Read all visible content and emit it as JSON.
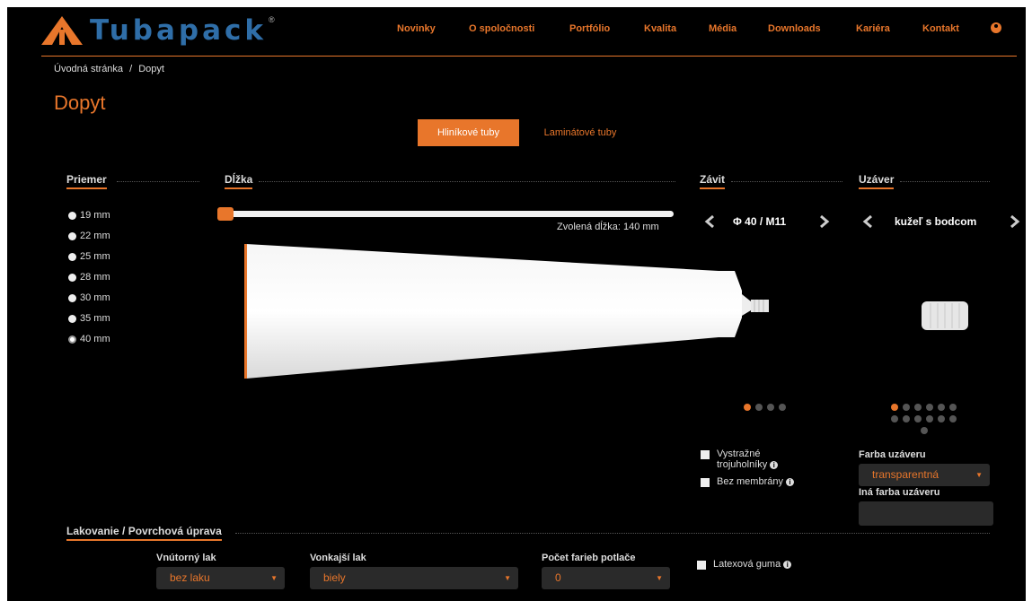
{
  "brand": {
    "name": "Tubapack",
    "reg": "®",
    "color": "#2f6ea8",
    "accent": "#e8762b"
  },
  "nav": {
    "items": [
      {
        "label": "Novinky"
      },
      {
        "label": "O spoločnosti"
      },
      {
        "label": "Portfólio"
      },
      {
        "label": "Kvalita"
      },
      {
        "label": "Média"
      },
      {
        "label": "Downloads"
      },
      {
        "label": "Kariéra"
      },
      {
        "label": "Kontakt"
      }
    ],
    "user_icon": "user-circle-icon"
  },
  "breadcrumb": {
    "home": "Úvodná stránka",
    "sep": "/",
    "current": "Dopyt"
  },
  "page": {
    "title": "Dopyt"
  },
  "tabs": {
    "aluminum": "Hliníkové tuby",
    "laminate": "Laminátové tuby",
    "active": "aluminum"
  },
  "sections": {
    "diameter": "Priemer",
    "length": "Dĺžka",
    "thread": "Závit",
    "cap": "Uzáver",
    "lacquer": "Lakovanie / Povrchová úprava"
  },
  "diameters": [
    "19 mm",
    "22 mm",
    "25 mm",
    "28 mm",
    "30 mm",
    "35 mm",
    "40 mm"
  ],
  "selected_diameter": "40 mm",
  "length": {
    "note": "Zvolená dĺžka: 140 mm",
    "value_mm": 140
  },
  "thread": {
    "label": "Φ 40 / M11",
    "page": 1,
    "pages": 4
  },
  "cap": {
    "label": "kužeľ s bodcom",
    "page": 1,
    "pages": 13
  },
  "options": {
    "warning_triangles": "Vystražné trojuholníky",
    "no_membrane": "Bez membrány",
    "latex": "Latexová guma"
  },
  "cap_color": {
    "label": "Farba uzáveru",
    "value": "transparentná",
    "other_label": "Iná farba uzáveru",
    "other_value": ""
  },
  "lacquer": {
    "inner": {
      "label": "Vnútorný lak",
      "value": "bez laku"
    },
    "outer": {
      "label": "Vonkajší lak",
      "value": "biely"
    },
    "colors": {
      "label": "Počet farieb potlače",
      "value": "0"
    }
  }
}
